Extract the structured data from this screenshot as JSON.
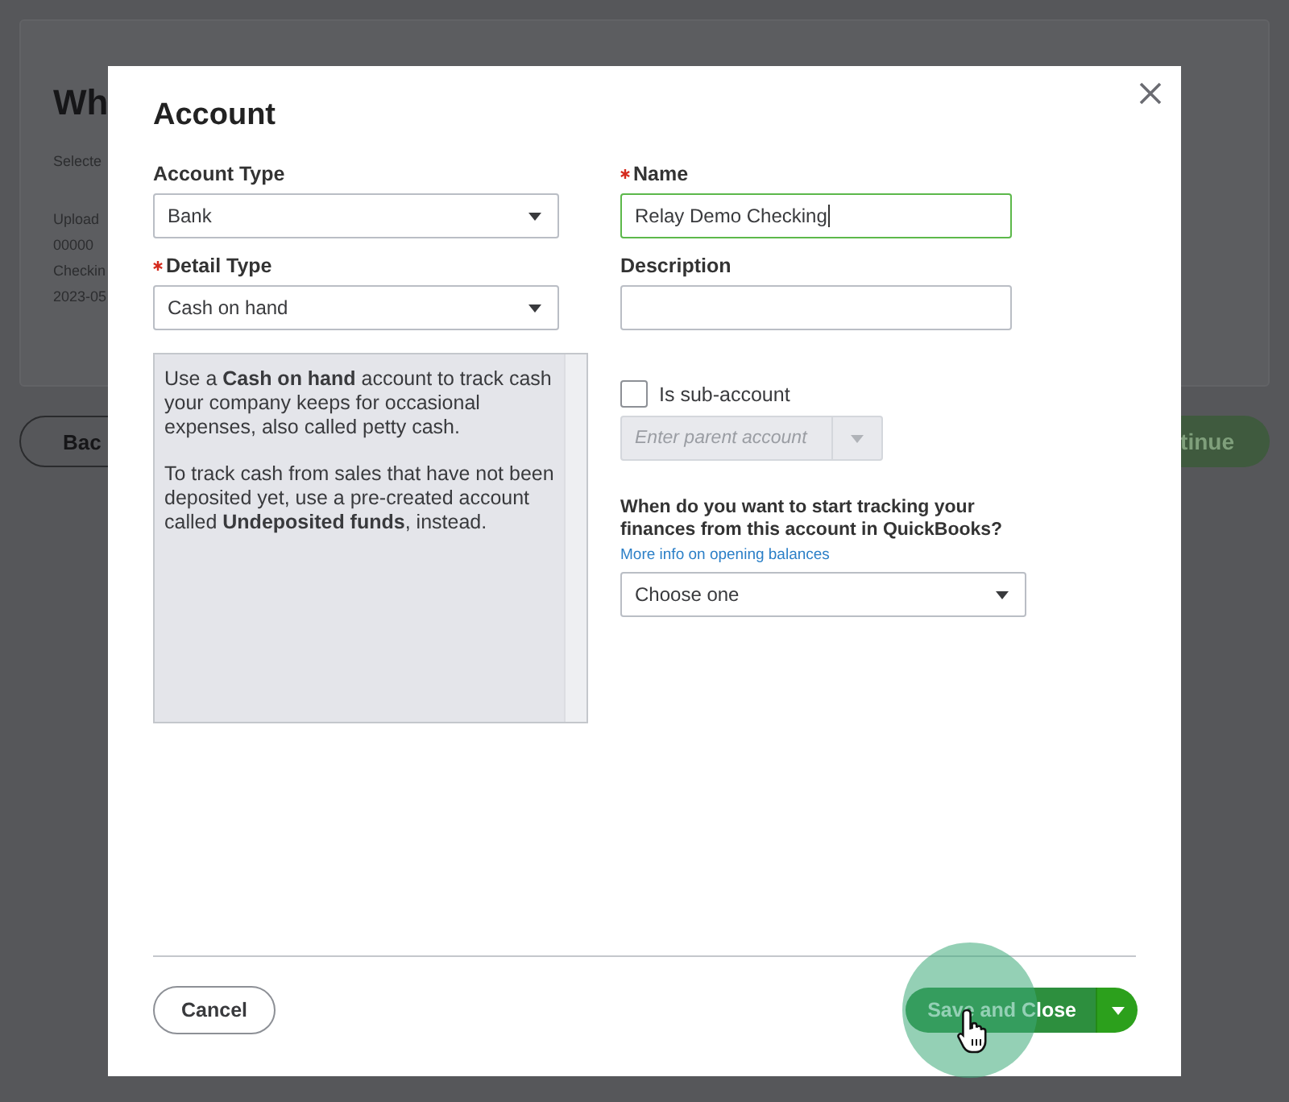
{
  "background": {
    "heading": "Wh",
    "lines": [
      "Selecte",
      "Upload",
      "00000",
      "Checkin",
      "2023-05"
    ],
    "back_button": "Bac",
    "continue_button": "tinue"
  },
  "dialog": {
    "title": "Account",
    "account_type": {
      "label": "Account Type",
      "required": false,
      "value": "Bank"
    },
    "detail_type": {
      "label": "Detail Type",
      "required": true,
      "value": "Cash on hand"
    },
    "detail_help": [
      "Use a **Cash on hand** account to track cash your company keeps for occasional expenses, also called petty cash.",
      "To track cash from sales that have not been deposited yet, use a pre-created account called **Undeposited funds**, instead."
    ],
    "name": {
      "label": "Name",
      "required": true,
      "value": "Relay Demo Checking",
      "focused": true
    },
    "description": {
      "label": "Description",
      "required": false
    },
    "sub_account": {
      "label": "Is sub-account",
      "checked": false
    },
    "parent_account": {
      "placeholder": "Enter parent account",
      "disabled": true
    },
    "tracking": {
      "question": "When do you want to start tracking your finances from this account in QuickBooks?",
      "link": "More info on opening balances",
      "value": "Choose one"
    },
    "cancel_button": "Cancel",
    "save_button": "Save and Close"
  }
}
